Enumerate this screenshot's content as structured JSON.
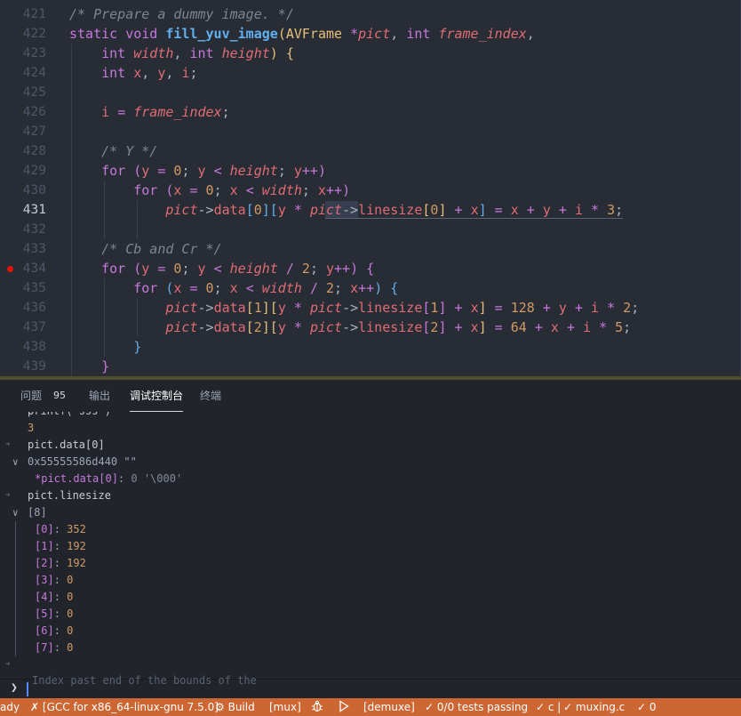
{
  "editor": {
    "lines": [
      {
        "num": "421",
        "tokens": [
          [
            "c-com",
            "/* Prepare a dummy image. */"
          ]
        ]
      },
      {
        "num": "422",
        "tokens": [
          [
            "c-ty",
            "static "
          ],
          [
            "c-ty",
            "void "
          ],
          [
            "c-fn",
            "fill_yuv_image"
          ],
          [
            "c-br1",
            "("
          ],
          [
            "c-cls",
            "AVFrame "
          ],
          [
            "c-op",
            "*"
          ],
          [
            "c-par",
            "pict"
          ],
          [
            "c-pun",
            ", "
          ],
          [
            "c-ty",
            "int "
          ],
          [
            "c-par",
            "frame_index"
          ],
          [
            "c-pun",
            ","
          ]
        ]
      },
      {
        "num": "423",
        "tokens": [
          [
            "c-pun",
            "    "
          ],
          [
            "c-ty",
            "int "
          ],
          [
            "c-par",
            "width"
          ],
          [
            "c-pun",
            ", "
          ],
          [
            "c-ty",
            "int "
          ],
          [
            "c-par",
            "height"
          ],
          [
            "c-br1",
            ")"
          ],
          [
            "c-pun",
            " "
          ],
          [
            "c-br1",
            "{"
          ]
        ]
      },
      {
        "num": "424",
        "tokens": [
          [
            "c-pun",
            "    "
          ],
          [
            "c-ty",
            "int "
          ],
          [
            "c-var",
            "x"
          ],
          [
            "c-pun",
            ", "
          ],
          [
            "c-var",
            "y"
          ],
          [
            "c-pun",
            ", "
          ],
          [
            "c-var",
            "i"
          ],
          [
            "c-pun",
            ";"
          ]
        ]
      },
      {
        "num": "425",
        "tokens": []
      },
      {
        "num": "426",
        "tokens": [
          [
            "c-pun",
            "    "
          ],
          [
            "c-var",
            "i "
          ],
          [
            "c-op",
            "= "
          ],
          [
            "c-par",
            "frame_index"
          ],
          [
            "c-pun",
            ";"
          ]
        ]
      },
      {
        "num": "427",
        "tokens": []
      },
      {
        "num": "428",
        "tokens": [
          [
            "c-pun",
            "    "
          ],
          [
            "c-com",
            "/* Y */"
          ]
        ]
      },
      {
        "num": "429",
        "tokens": [
          [
            "c-pun",
            "    "
          ],
          [
            "c-kw",
            "for "
          ],
          [
            "c-br2",
            "("
          ],
          [
            "c-var",
            "y "
          ],
          [
            "c-op",
            "= "
          ],
          [
            "c-num",
            "0"
          ],
          [
            "c-pun",
            "; "
          ],
          [
            "c-var",
            "y "
          ],
          [
            "c-op",
            "< "
          ],
          [
            "c-par",
            "height"
          ],
          [
            "c-pun",
            "; "
          ],
          [
            "c-var",
            "y"
          ],
          [
            "c-op",
            "++"
          ],
          [
            "c-br2",
            ")"
          ]
        ]
      },
      {
        "num": "430",
        "tokens": [
          [
            "c-pun",
            "        "
          ],
          [
            "c-kw",
            "for "
          ],
          [
            "c-br2",
            "("
          ],
          [
            "c-var",
            "x "
          ],
          [
            "c-op",
            "= "
          ],
          [
            "c-num",
            "0"
          ],
          [
            "c-pun",
            "; "
          ],
          [
            "c-var",
            "x "
          ],
          [
            "c-op",
            "< "
          ],
          [
            "c-par",
            "width"
          ],
          [
            "c-pun",
            "; "
          ],
          [
            "c-var",
            "x"
          ],
          [
            "c-op",
            "++"
          ],
          [
            "c-br2",
            ")"
          ]
        ]
      },
      {
        "num": "431",
        "active": true,
        "tokens": [
          [
            "c-pun",
            "            "
          ],
          [
            "c-par",
            "pict"
          ],
          [
            "c-ar",
            "->"
          ],
          [
            "c-fld",
            "data"
          ],
          [
            "c-br3",
            "["
          ],
          [
            "c-num",
            "0"
          ],
          [
            "c-br3",
            "]"
          ],
          [
            "c-br3",
            "["
          ],
          [
            "c-var",
            "y "
          ],
          [
            "c-op",
            "* "
          ],
          [
            "c-par",
            "pict"
          ],
          [
            "c-ar",
            "->"
          ],
          [
            "c-fld",
            "linesize"
          ],
          [
            "c-br1",
            "["
          ],
          [
            "c-num",
            "0"
          ],
          [
            "c-br1",
            "]"
          ],
          [
            "c-pun",
            " "
          ],
          [
            "c-op",
            "+ "
          ],
          [
            "c-var",
            "x"
          ],
          [
            "c-br3",
            "]"
          ],
          [
            "c-pun",
            " "
          ],
          [
            "c-op",
            "= "
          ],
          [
            "c-var",
            "x "
          ],
          [
            "c-op",
            "+ "
          ],
          [
            "c-var",
            "y "
          ],
          [
            "c-op",
            "+ "
          ],
          [
            "c-var",
            "i "
          ],
          [
            "c-op",
            "* "
          ],
          [
            "c-num",
            "3"
          ],
          [
            "c-pun",
            ";"
          ]
        ]
      },
      {
        "num": "432",
        "tokens": []
      },
      {
        "num": "433",
        "tokens": [
          [
            "c-pun",
            "    "
          ],
          [
            "c-com",
            "/* Cb and Cr */"
          ]
        ]
      },
      {
        "num": "434",
        "breakpoint": true,
        "tokens": [
          [
            "c-pun",
            "    "
          ],
          [
            "c-kw",
            "for "
          ],
          [
            "c-br2",
            "("
          ],
          [
            "c-var",
            "y "
          ],
          [
            "c-op",
            "= "
          ],
          [
            "c-num",
            "0"
          ],
          [
            "c-pun",
            "; "
          ],
          [
            "c-var",
            "y "
          ],
          [
            "c-op",
            "< "
          ],
          [
            "c-par",
            "height "
          ],
          [
            "c-op",
            "/ "
          ],
          [
            "c-num",
            "2"
          ],
          [
            "c-pun",
            "; "
          ],
          [
            "c-var",
            "y"
          ],
          [
            "c-op",
            "++"
          ],
          [
            "c-br2",
            ")"
          ],
          [
            "c-pun",
            " "
          ],
          [
            "c-br2",
            "{"
          ]
        ]
      },
      {
        "num": "435",
        "tokens": [
          [
            "c-pun",
            "        "
          ],
          [
            "c-kw",
            "for "
          ],
          [
            "c-br3",
            "("
          ],
          [
            "c-var",
            "x "
          ],
          [
            "c-op",
            "= "
          ],
          [
            "c-num",
            "0"
          ],
          [
            "c-pun",
            "; "
          ],
          [
            "c-var",
            "x "
          ],
          [
            "c-op",
            "< "
          ],
          [
            "c-par",
            "width "
          ],
          [
            "c-op",
            "/ "
          ],
          [
            "c-num",
            "2"
          ],
          [
            "c-pun",
            "; "
          ],
          [
            "c-var",
            "x"
          ],
          [
            "c-op",
            "++"
          ],
          [
            "c-br3",
            ")"
          ],
          [
            "c-pun",
            " "
          ],
          [
            "c-br3",
            "{"
          ]
        ]
      },
      {
        "num": "436",
        "tokens": [
          [
            "c-pun",
            "            "
          ],
          [
            "c-par",
            "pict"
          ],
          [
            "c-ar",
            "->"
          ],
          [
            "c-fld",
            "data"
          ],
          [
            "c-br1",
            "["
          ],
          [
            "c-num",
            "1"
          ],
          [
            "c-br1",
            "]"
          ],
          [
            "c-br1",
            "["
          ],
          [
            "c-var",
            "y "
          ],
          [
            "c-op",
            "* "
          ],
          [
            "c-par",
            "pict"
          ],
          [
            "c-ar",
            "->"
          ],
          [
            "c-fld",
            "linesize"
          ],
          [
            "c-br2",
            "["
          ],
          [
            "c-num",
            "1"
          ],
          [
            "c-br2",
            "]"
          ],
          [
            "c-pun",
            " "
          ],
          [
            "c-op",
            "+ "
          ],
          [
            "c-var",
            "x"
          ],
          [
            "c-br1",
            "]"
          ],
          [
            "c-pun",
            " "
          ],
          [
            "c-op",
            "= "
          ],
          [
            "c-num",
            "128 "
          ],
          [
            "c-op",
            "+ "
          ],
          [
            "c-var",
            "y "
          ],
          [
            "c-op",
            "+ "
          ],
          [
            "c-var",
            "i "
          ],
          [
            "c-op",
            "* "
          ],
          [
            "c-num",
            "2"
          ],
          [
            "c-pun",
            ";"
          ]
        ]
      },
      {
        "num": "437",
        "tokens": [
          [
            "c-pun",
            "            "
          ],
          [
            "c-par",
            "pict"
          ],
          [
            "c-ar",
            "->"
          ],
          [
            "c-fld",
            "data"
          ],
          [
            "c-br1",
            "["
          ],
          [
            "c-num",
            "2"
          ],
          [
            "c-br1",
            "]"
          ],
          [
            "c-br1",
            "["
          ],
          [
            "c-var",
            "y "
          ],
          [
            "c-op",
            "* "
          ],
          [
            "c-par",
            "pict"
          ],
          [
            "c-ar",
            "->"
          ],
          [
            "c-fld",
            "linesize"
          ],
          [
            "c-br2",
            "["
          ],
          [
            "c-num",
            "2"
          ],
          [
            "c-br2",
            "]"
          ],
          [
            "c-pun",
            " "
          ],
          [
            "c-op",
            "+ "
          ],
          [
            "c-var",
            "x"
          ],
          [
            "c-br1",
            "]"
          ],
          [
            "c-pun",
            " "
          ],
          [
            "c-op",
            "= "
          ],
          [
            "c-num",
            "64 "
          ],
          [
            "c-op",
            "+ "
          ],
          [
            "c-var",
            "x "
          ],
          [
            "c-op",
            "+ "
          ],
          [
            "c-var",
            "i "
          ],
          [
            "c-op",
            "* "
          ],
          [
            "c-num",
            "5"
          ],
          [
            "c-pun",
            ";"
          ]
        ]
      },
      {
        "num": "438",
        "tokens": [
          [
            "c-pun",
            "        "
          ],
          [
            "c-br3",
            "}"
          ]
        ]
      },
      {
        "num": "439",
        "tokens": [
          [
            "c-pun",
            "    "
          ],
          [
            "c-br2",
            "}"
          ]
        ]
      }
    ]
  },
  "panel": {
    "tabs": [
      {
        "label": "问题",
        "active": false
      },
      {
        "label": "输出",
        "active": false
      },
      {
        "label": "调试控制台",
        "active": true
      },
      {
        "label": "终端",
        "active": false
      }
    ],
    "problems_count": "95"
  },
  "console": {
    "clipped_top": "printf(\"sss\")",
    "rows": [
      {
        "kind": "result",
        "text": "3"
      },
      {
        "kind": "input",
        "text": "pict.data[0]"
      },
      {
        "kind": "expanded",
        "text": "0x55555586d440 \"\""
      },
      {
        "kind": "child",
        "key": "*pict.data[0]",
        "val": "0 '\\000'"
      },
      {
        "kind": "input",
        "text": "pict.linesize"
      },
      {
        "kind": "expanded",
        "text": "[8]"
      },
      {
        "kind": "item",
        "key": "[0]",
        "val": "352"
      },
      {
        "kind": "item",
        "key": "[1]",
        "val": "192"
      },
      {
        "kind": "item",
        "key": "[2]",
        "val": "192"
      },
      {
        "kind": "item",
        "key": "[3]",
        "val": "0"
      },
      {
        "kind": "item",
        "key": "[4]",
        "val": "0"
      },
      {
        "kind": "item",
        "key": "[5]",
        "val": "0"
      },
      {
        "kind": "item",
        "key": "[6]",
        "val": "0"
      },
      {
        "kind": "item",
        "key": "[7]",
        "val": "0"
      },
      {
        "kind": "input",
        "text": ""
      }
    ],
    "ghost_text": "Index past end of the bounds of the",
    "prompt": "❯"
  },
  "statusbar": {
    "items": {
      "ready": "ady",
      "kit": "[GCC for x86_64-linux-gnu 7.5.0]",
      "build": "Build",
      "target": "[mux]",
      "debug_icon": "bug-icon",
      "run_icon": "play-icon",
      "launch": "[demuxe]",
      "tests": "0/0 tests passing",
      "lang": "c |",
      "file": "muxing.c",
      "zero": "0"
    },
    "color": "#cc6633"
  },
  "colors": {
    "editor_bg": "#282c34",
    "panel_bg": "#21252b",
    "statusbar": "#cc6633",
    "breakpoint": "#e51400"
  }
}
